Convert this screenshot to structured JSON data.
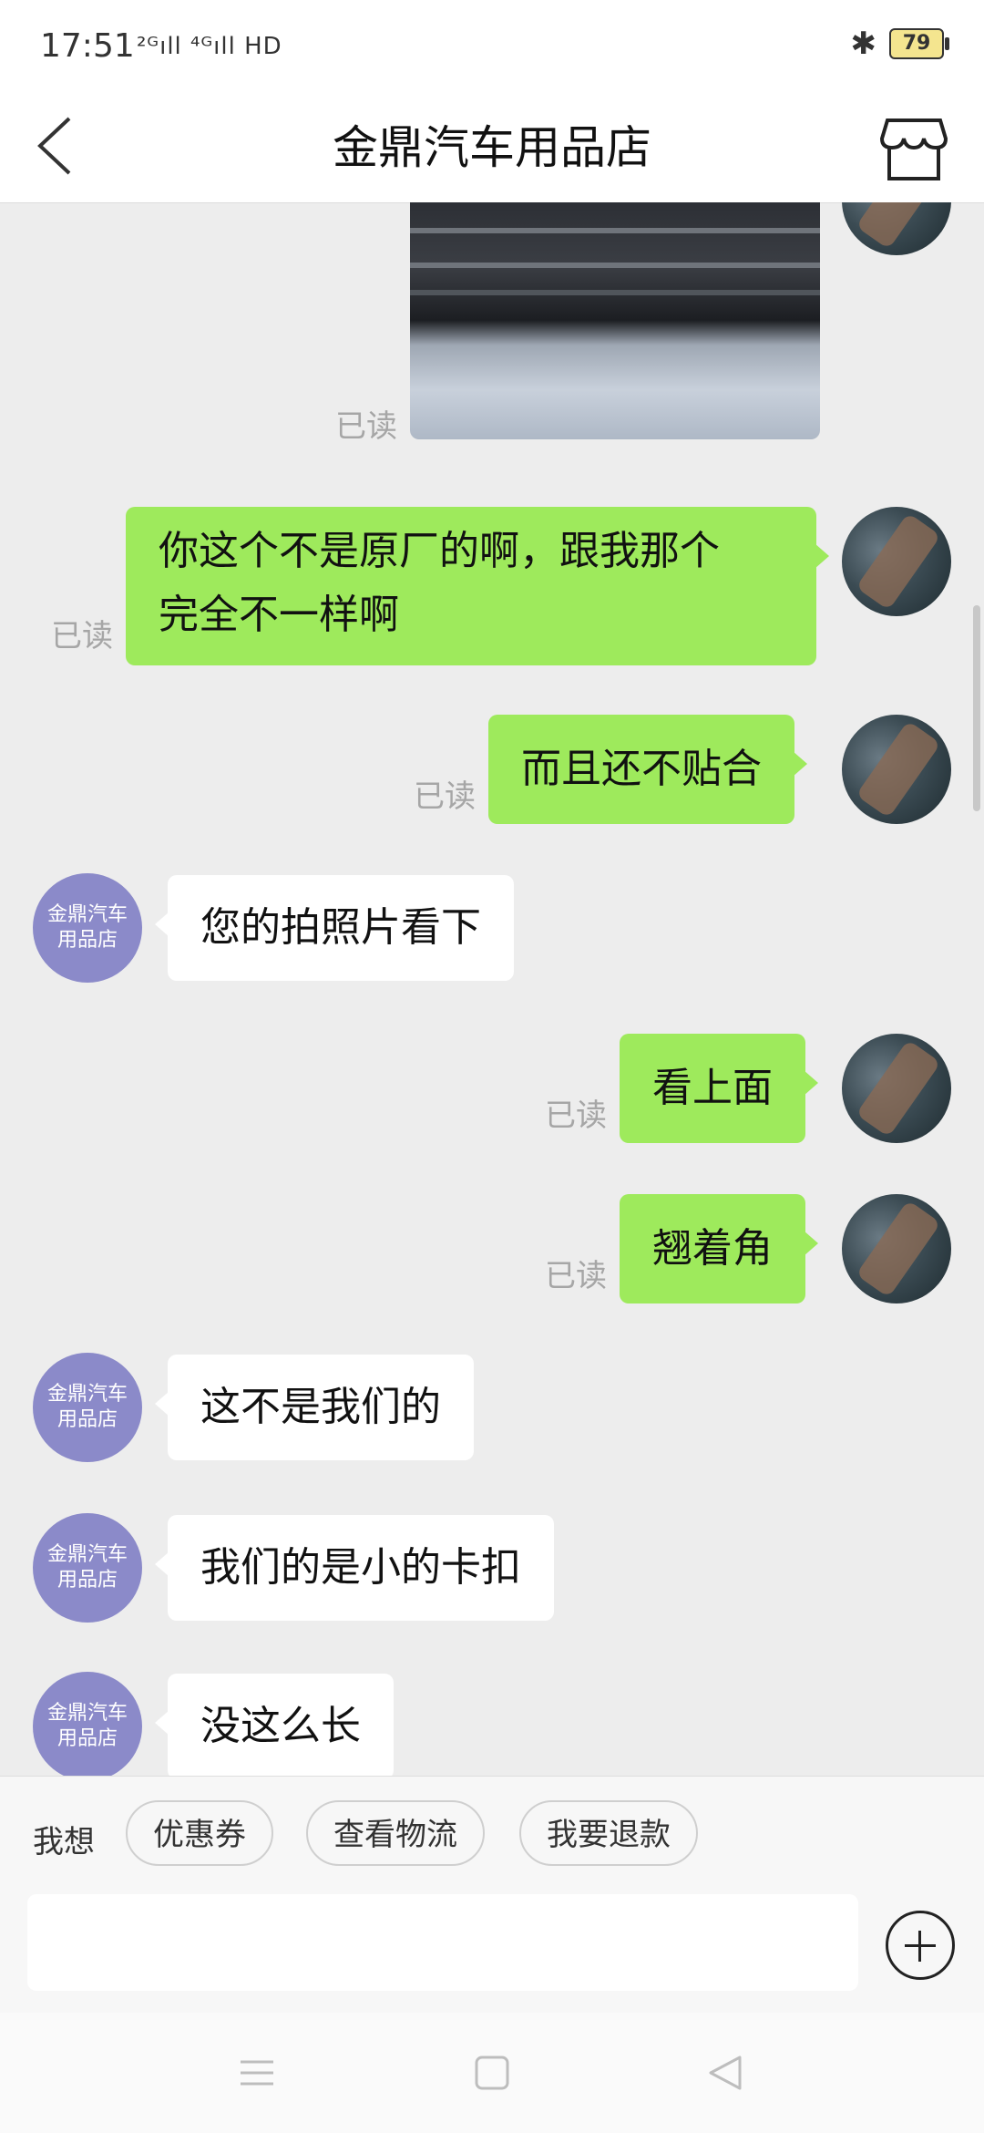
{
  "status": {
    "time": "17:51",
    "signal": "²ᴳıll ⁴ᴳıll HD",
    "battery": "79"
  },
  "header": {
    "title": "金鼎汽车用品店"
  },
  "messages": {
    "read": "已读",
    "m1": "你这个不是原厂的啊，跟我那个",
    "m1b": "完全不一样啊",
    "m2": "而且还不贴合",
    "s1": "您的拍照片看下",
    "m3": "看上面",
    "m4": "翘着角",
    "s2": "这不是我们的",
    "s3": "我们的是小的卡扣",
    "s4": "没这么长",
    "shop_avatar_line1": "金鼎汽车",
    "shop_avatar_line2": "用品店"
  },
  "quick": {
    "label": "我想",
    "chips": [
      "优惠券",
      "查看物流",
      "我要退款"
    ]
  },
  "input": {
    "placeholder": ""
  },
  "icons": [
    "back-icon",
    "store-icon",
    "bluetooth-icon",
    "plus-icon",
    "menu-icon",
    "home-icon",
    "back-nav-icon"
  ]
}
